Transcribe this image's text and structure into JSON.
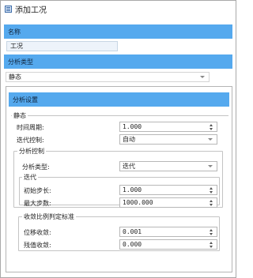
{
  "window": {
    "title": "添加工况"
  },
  "name_section": {
    "header": "名称",
    "value": "工况"
  },
  "analysis_type_section": {
    "header": "分析类型",
    "selected": "静态"
  },
  "analysis_settings": {
    "header": "分析设置",
    "static_group": {
      "title": "静态",
      "time_period": {
        "label": "时间周期:",
        "value": "1.000"
      },
      "iteration_control": {
        "label": "迭代控制:",
        "selected": "自动"
      }
    },
    "analysis_control": {
      "title": "分析控制",
      "analysis_type": {
        "label": "分析类型:",
        "selected": "迭代"
      },
      "iteration": {
        "title": "迭代",
        "initial_step": {
          "label": "初始步长:",
          "value": "1.000"
        },
        "max_steps": {
          "label": "最大步数:",
          "value": "1000.000"
        }
      }
    },
    "convergence": {
      "title": "收敛比例判定标准",
      "displacement": {
        "label": "位移收敛:",
        "value": "0.001"
      },
      "residual": {
        "label": "残值收敛:",
        "value": "0.000"
      }
    }
  },
  "colors": {
    "section_header": "#55a9ee",
    "field_bg": "#edf3fa",
    "border": "#b7b7b7"
  },
  "icons": {
    "title": "form-icon",
    "combo": "chevron-down-icon",
    "spin": "spin-arrows-icon"
  }
}
